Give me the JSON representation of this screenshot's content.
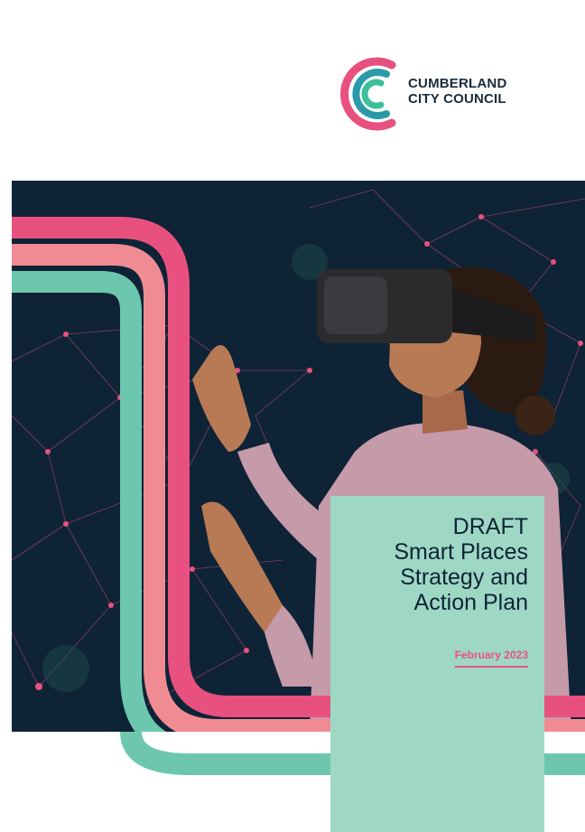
{
  "logo": {
    "line1": "CUMBERLAND",
    "line2": "CITY COUNCIL",
    "icon": "cumberland-c-rings-logo",
    "colors": [
      "#e8517f",
      "#2a9aa8",
      "#3cc09c"
    ]
  },
  "title": {
    "line1": "DRAFT",
    "line2": "Smart Places",
    "line3": "Strategy and",
    "line4": "Action Plan"
  },
  "date": "February 2023",
  "colors": {
    "navy": "#0e2336",
    "pink": "#e8517f",
    "salmon": "#f08b94",
    "mint": "#9ed8c5",
    "teal": "#6cc7ae"
  },
  "photo": {
    "subject": "woman-wearing-vr-headset"
  }
}
